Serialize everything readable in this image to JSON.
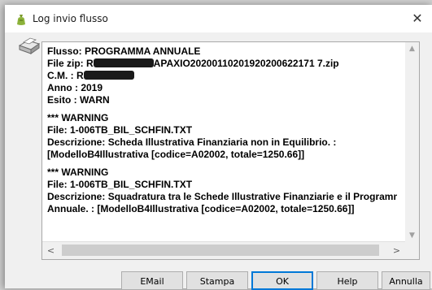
{
  "window": {
    "title": "Log invio flusso",
    "close_glyph": "✕",
    "app_icon": "sack-icon"
  },
  "log": {
    "icon": "printer-icon",
    "lines": {
      "flusso": "Flusso: PROGRAMMA ANNUALE",
      "file_zip_prefix": "File zip: R",
      "file_zip_suffix": "APAXIO20200110201920200622171 7.zip",
      "cm_prefix": "C.M. : R",
      "anno": "Anno : 2019",
      "esito": "Esito : WARN",
      "w1_header": "*** WARNING",
      "w1_file": "File: 1-006TB_BIL_SCHFIN.TXT",
      "w1_desc1": "Descrizione: Scheda Illustrativa Finanziaria non in Equilibrio. :",
      "w1_desc2": "[ModelloB4Illustrativa [codice=A02002, totale=1250.66]]",
      "w2_header": "*** WARNING",
      "w2_file": "File: 1-006TB_BIL_SCHFIN.TXT",
      "w2_desc1": "Descrizione: Squadratura tra le Schede Illustrative Finanziarie e il Programma",
      "w2_desc2": "Annuale. : [ModelloB4Illustrativa [codice=A02002, totale=1250.66]]"
    },
    "scroll_left": "<",
    "scroll_right": ">",
    "scroll_up": "▲",
    "scroll_down": "▼"
  },
  "buttons": {
    "email": "EMail",
    "stampa": "Stampa",
    "ok": "OK",
    "help": "Help",
    "annulla": "Annulla"
  },
  "colors": {
    "accent": "#0078d7",
    "button_bg": "#e1e1e1",
    "window_bg": "#f0f0f0"
  }
}
